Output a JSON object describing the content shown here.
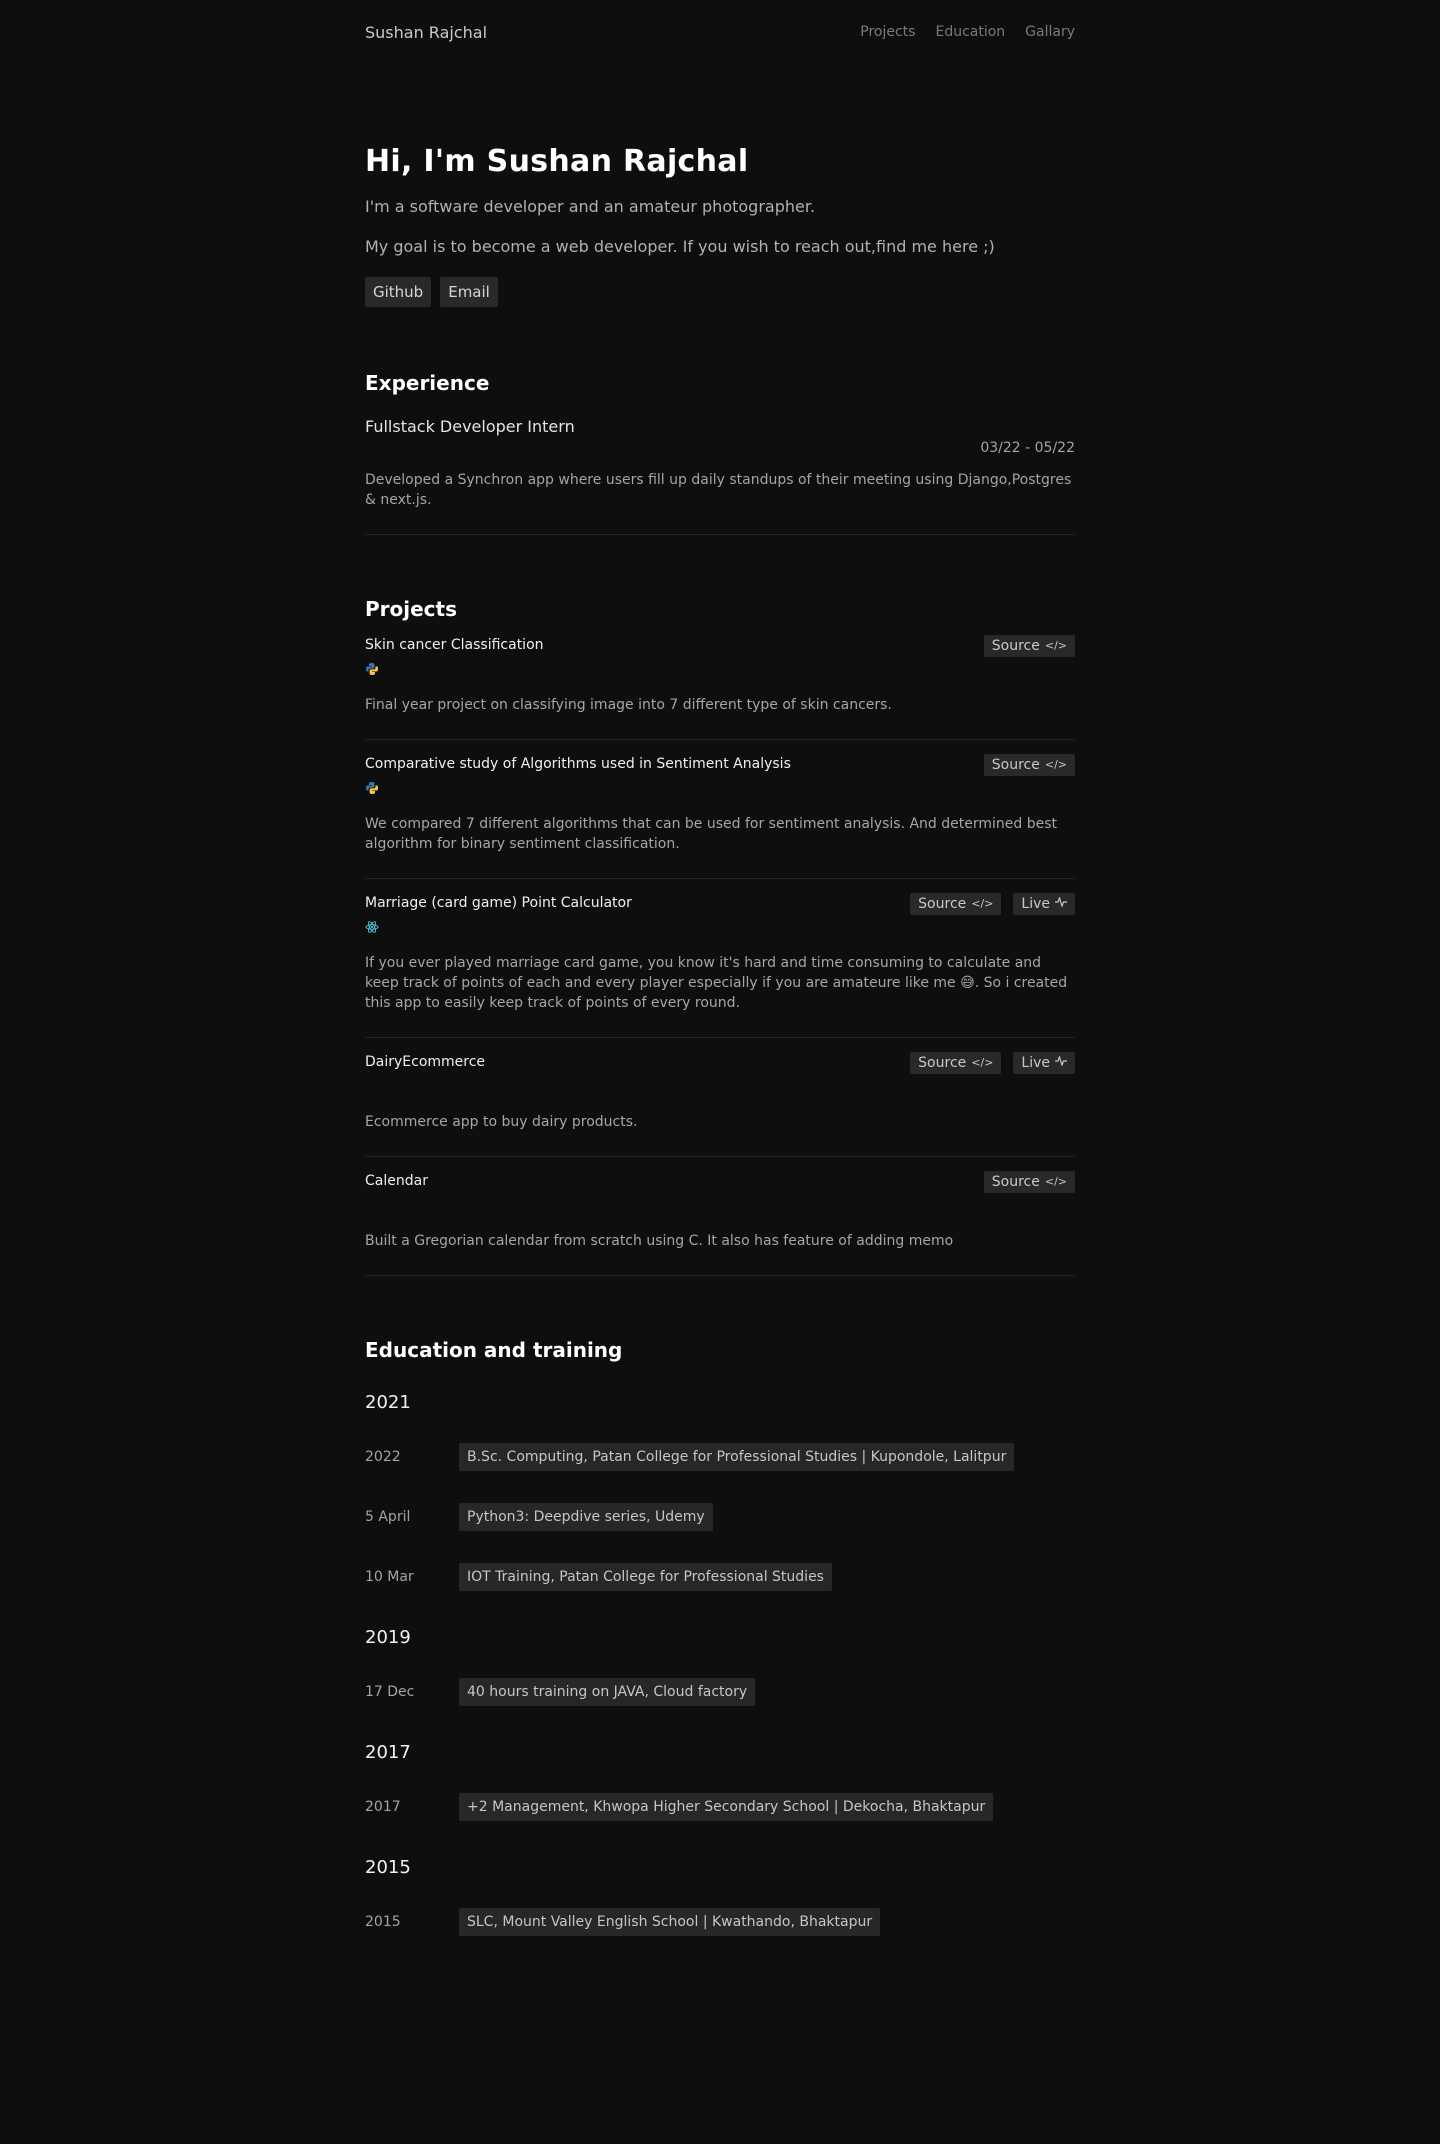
{
  "nav": {
    "brand": "Sushan Rajchal",
    "links": [
      {
        "label": "Projects"
      },
      {
        "label": "Education"
      },
      {
        "label": "Gallary"
      }
    ]
  },
  "hero": {
    "title": "Hi, I'm Sushan Rajchal",
    "line1": "I'm a software developer and an amateur photographer.",
    "line2": "My goal is to become a web developer. If you wish to reach out,find me here ;)",
    "buttons": [
      {
        "label": "Github"
      },
      {
        "label": "Email"
      }
    ]
  },
  "experience": {
    "heading": "Experience",
    "items": [
      {
        "title": "Fullstack Developer Intern",
        "date": "03/22 - 05/22",
        "description": "Developed a Synchron app where users fill up daily standups of their meeting using Django,Postgres & next.js."
      }
    ]
  },
  "projects": {
    "heading": "Projects",
    "source_label": "Source",
    "live_label": "Live",
    "source_icon": "code-icon",
    "live_icon": "activity-icon",
    "items": [
      {
        "title": "Skin cancer Classification",
        "tech_icon": "python-icon",
        "description": "Final year project on classifying image into 7 different type of skin cancers.",
        "has_live": false
      },
      {
        "title": "Comparative study of Algorithms used in Sentiment Analysis",
        "tech_icon": "python-icon",
        "description": "We compared 7 different algorithms that can be used for sentiment analysis. And determined best algorithm for binary sentiment classification.",
        "has_live": false
      },
      {
        "title": "Marriage (card game) Point Calculator",
        "tech_icon": "react-icon",
        "description": "If you ever played marriage card game, you know it's hard and time consuming to calculate and keep track of points of each and every player especially if you are amateure like me 😅. So i created this app to easily keep track of points of every round.",
        "has_live": true
      },
      {
        "title": "DairyEcommerce",
        "tech_icon": "",
        "description": "Ecommerce app to buy dairy products.",
        "has_live": true
      },
      {
        "title": "Calendar",
        "tech_icon": "",
        "description": "Built a Gregorian calendar from scratch using C. It also has feature of adding memo",
        "has_live": false
      }
    ]
  },
  "education": {
    "heading": "Education and training",
    "groups": [
      {
        "year": "2021",
        "items": [
          {
            "date": "2022",
            "label": "B.Sc. Computing, Patan College for Professional Studies | Kupondole, Lalitpur"
          },
          {
            "date": "5 April",
            "label": "Python3: Deepdive series, Udemy"
          },
          {
            "date": "10 Mar",
            "label": "IOT Training, Patan College for Professional Studies"
          }
        ]
      },
      {
        "year": "2019",
        "items": [
          {
            "date": "17 Dec",
            "label": "40 hours training on JAVA, Cloud factory"
          }
        ]
      },
      {
        "year": "2017",
        "items": [
          {
            "date": "2017",
            "label": "+2 Management, Khwopa Higher Secondary School | Dekocha, Bhaktapur"
          }
        ]
      },
      {
        "year": "2015",
        "items": [
          {
            "date": "2015",
            "label": "SLC, Mount Valley English School | Kwathando, Bhaktapur"
          }
        ]
      }
    ]
  }
}
